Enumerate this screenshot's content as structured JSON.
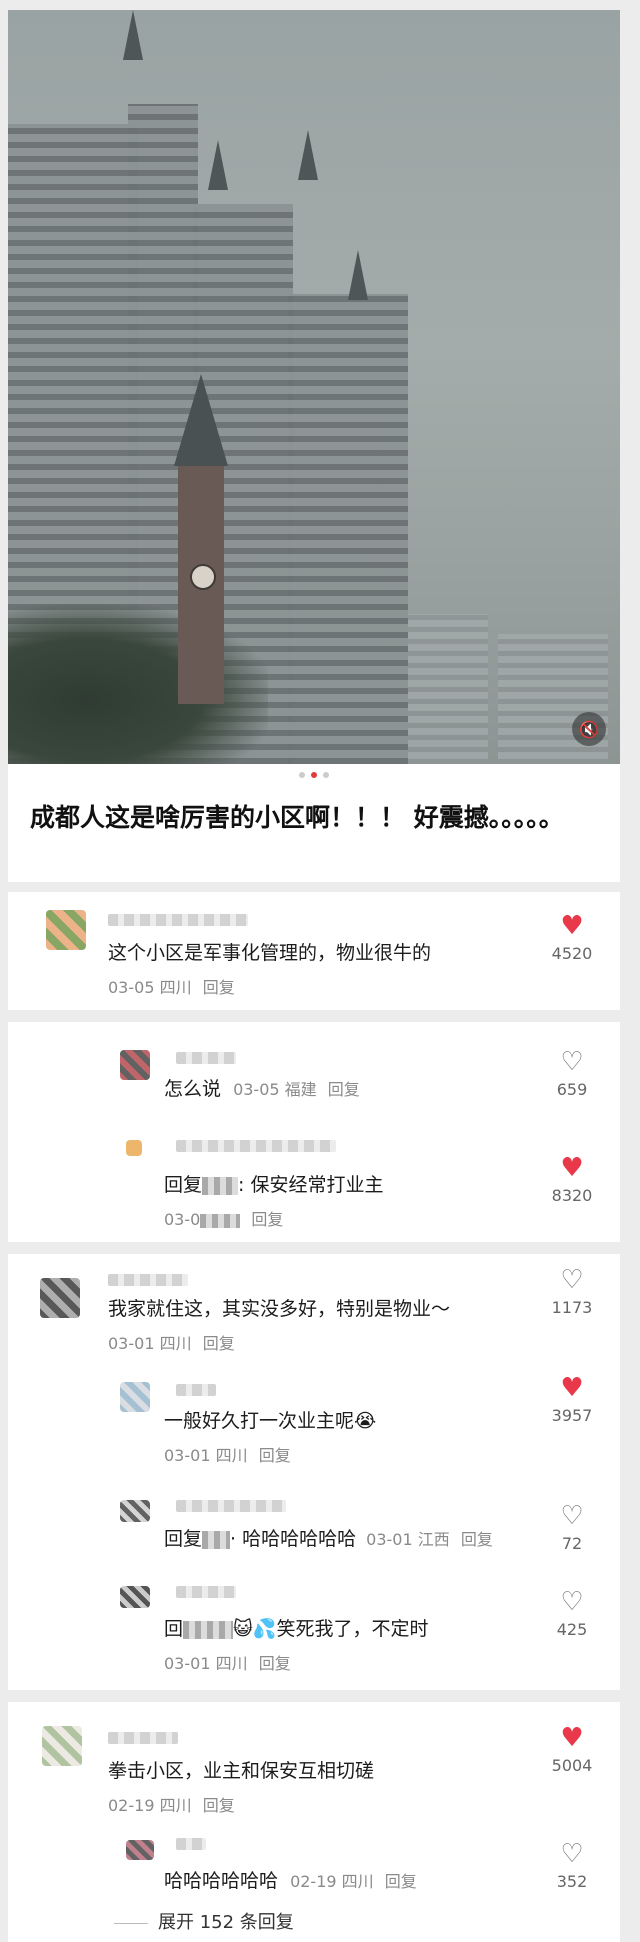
{
  "post": {
    "title": "成都人这是啥厉害的小区啊！！！ 好震撼。。。。。",
    "carousel_index": 2,
    "carousel_total": 3
  },
  "threads": [
    {
      "text": "这个小区是军事化管理的，物业很牛的",
      "date": "03-05",
      "location": "四川",
      "reply_label": "回复",
      "likes": "4520",
      "liked": true,
      "replies": []
    },
    {
      "replies": [
        {
          "text": "怎么说",
          "date": "03-05",
          "location": "福建",
          "reply_label": "回复",
          "likes": "659",
          "liked": false
        },
        {
          "prefix": "回复",
          "text": ": 保安经常打业主",
          "date": "03-0",
          "reply_label": "回复",
          "likes": "8320",
          "liked": true
        }
      ]
    },
    {
      "text": "我家就住这，其实没多好，特别是物业～",
      "date": "03-01",
      "location": "四川",
      "reply_label": "回复",
      "likes": "1173",
      "liked": false,
      "replies": [
        {
          "text": "一般好久打一次业主呢😭",
          "date": "03-01",
          "location": "四川",
          "reply_label": "回复",
          "likes": "3957",
          "liked": true
        },
        {
          "prefix": "回复",
          "text": "· 哈哈哈哈哈哈",
          "date": "03-01",
          "location": "江西",
          "reply_label": "回复",
          "likes": "72",
          "liked": false
        },
        {
          "prefix": "回",
          "text": "😺💦笑死我了，不定时",
          "date": "03-01",
          "location": "四川",
          "reply_label": "回复",
          "likes": "425",
          "liked": false
        }
      ]
    },
    {
      "text": "拳击小区，业主和保安互相切磋",
      "date": "02-19",
      "location": "四川",
      "reply_label": "回复",
      "likes": "5004",
      "liked": true,
      "replies": [
        {
          "text": "哈哈哈哈哈哈",
          "date": "02-19",
          "location": "四川",
          "reply_label": "回复",
          "likes": "352",
          "liked": false
        }
      ],
      "expand_label": "展开 152 条回复"
    }
  ],
  "icons": {
    "heart_filled": "♥",
    "heart_empty": "♡",
    "mute": "🔇"
  },
  "colors": {
    "like_red": "#e8384a",
    "dot_active": "#e23a3a"
  }
}
